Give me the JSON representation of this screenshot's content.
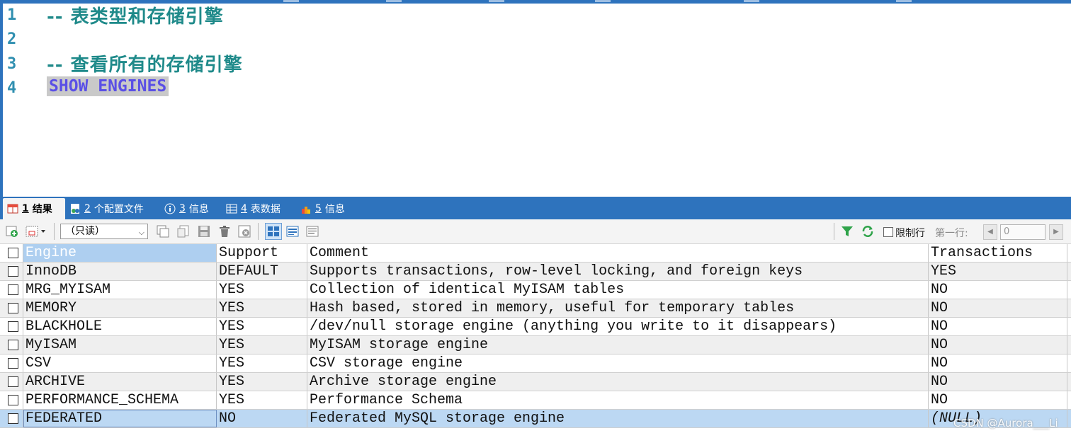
{
  "editor": {
    "lines": [
      {
        "num": "1",
        "text": "-- 表类型和存储引擎"
      },
      {
        "num": "2",
        "text": ""
      },
      {
        "num": "3",
        "text": "-- 查看所有的存储引擎"
      },
      {
        "num": "4",
        "text": "SHOW ENGINES"
      }
    ]
  },
  "tabs": [
    {
      "num": "1",
      "label": "结果",
      "icon": "result-grid-icon"
    },
    {
      "num": "2",
      "label": "个配置文件",
      "icon": "profile-icon"
    },
    {
      "num": "3",
      "label": "信息",
      "icon": "info-icon"
    },
    {
      "num": "4",
      "label": "表数据",
      "icon": "table-data-icon"
    },
    {
      "num": "5",
      "label": "信息",
      "icon": "info-bars-icon"
    }
  ],
  "toolbar": {
    "mode_select": "（只读）",
    "limit_label": "限制行",
    "first_row_label": "第一行:",
    "first_row_value": "0"
  },
  "grid": {
    "columns": [
      "Engine",
      "Support",
      "Comment",
      "Transactions"
    ],
    "rows": [
      [
        "InnoDB",
        "DEFAULT",
        "Supports transactions, row-level locking, and foreign keys",
        "YES"
      ],
      [
        "MRG_MYISAM",
        "YES",
        "Collection of identical MyISAM tables",
        "NO"
      ],
      [
        "MEMORY",
        "YES",
        "Hash based, stored in memory, useful for temporary tables",
        "NO"
      ],
      [
        "BLACKHOLE",
        "YES",
        "/dev/null storage engine (anything you write to it disappears)",
        "NO"
      ],
      [
        "MyISAM",
        "YES",
        "MyISAM storage engine",
        "NO"
      ],
      [
        "CSV",
        "YES",
        "CSV storage engine",
        "NO"
      ],
      [
        "ARCHIVE",
        "YES",
        "Archive storage engine",
        "NO"
      ],
      [
        "PERFORMANCE_SCHEMA",
        "YES",
        "Performance Schema",
        "NO"
      ],
      [
        "FEDERATED",
        "NO",
        "Federated MySQL storage engine",
        "(NULL)"
      ]
    ]
  },
  "watermark": "CSDN @Aurora___Li",
  "colors": {
    "accent": "#2e73bd",
    "selection": "#bcd8f3",
    "keyword": "#5a4fe6",
    "comment": "#1f8a8a"
  }
}
